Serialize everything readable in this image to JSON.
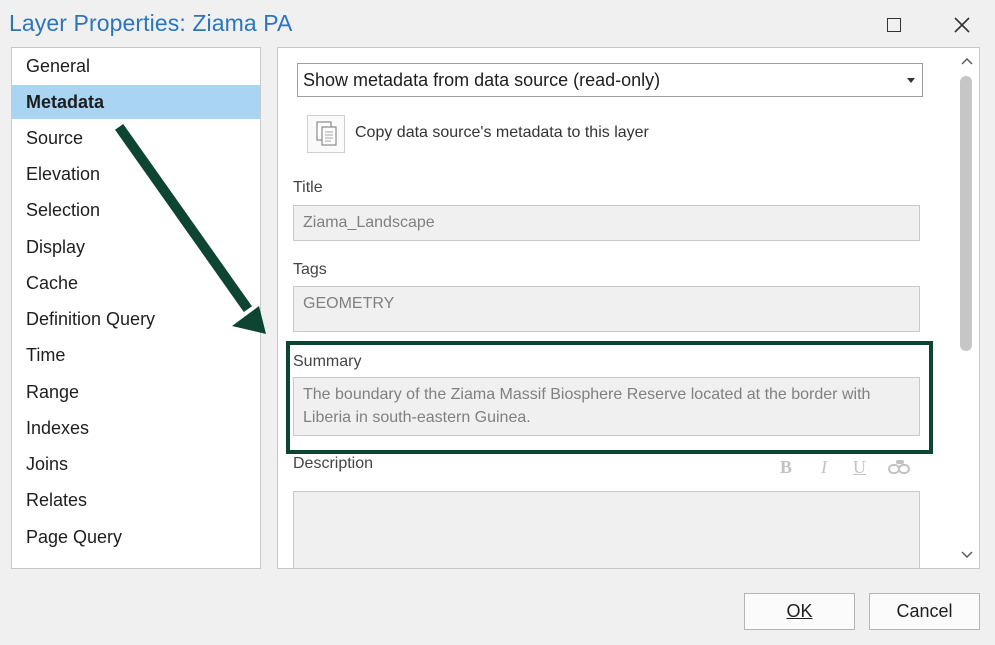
{
  "window": {
    "title": "Layer Properties: Ziama PA",
    "maximize_glyph": "",
    "close_glyph": "✕"
  },
  "sidebar": {
    "items": [
      {
        "label": "General",
        "active": false
      },
      {
        "label": "Metadata",
        "active": true
      },
      {
        "label": "Source",
        "active": false
      },
      {
        "label": "Elevation",
        "active": false
      },
      {
        "label": "Selection",
        "active": false
      },
      {
        "label": "Display",
        "active": false
      },
      {
        "label": "Cache",
        "active": false
      },
      {
        "label": "Definition Query",
        "active": false
      },
      {
        "label": "Time",
        "active": false
      },
      {
        "label": "Range",
        "active": false
      },
      {
        "label": "Indexes",
        "active": false
      },
      {
        "label": "Joins",
        "active": false
      },
      {
        "label": "Relates",
        "active": false
      },
      {
        "label": "Page Query",
        "active": false
      }
    ]
  },
  "metadata": {
    "source_dropdown_value": "Show metadata from data source (read-only)",
    "copy_label": "Copy data source's metadata to this layer",
    "title_label": "Title",
    "title_value": "Ziama_Landscape",
    "tags_label": "Tags",
    "tags_value": "GEOMETRY",
    "summary_label": "Summary",
    "summary_value": "The boundary of the Ziama Massif Biosphere Reserve located at the border with Liberia in south-eastern Guinea.",
    "description_label": "Description",
    "description_value": "",
    "format_bold": "B",
    "format_italic": "I",
    "format_underline": "U"
  },
  "footer": {
    "ok_label": "OK",
    "cancel_label": "Cancel"
  },
  "colors": {
    "title_blue": "#2b75ba",
    "active_item": "#a9d4f2",
    "annotation_green": "#0e4532"
  }
}
